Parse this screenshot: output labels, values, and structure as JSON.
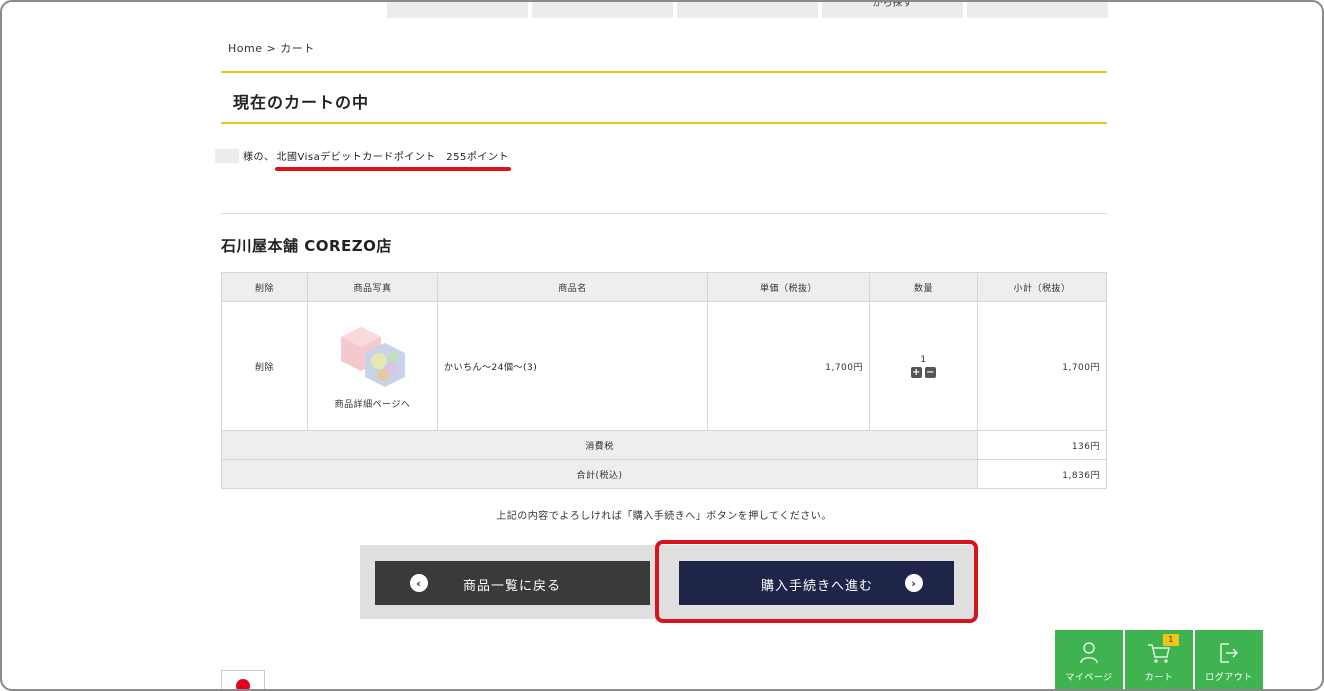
{
  "top_nav": {
    "tabs": [
      "",
      "",
      "",
      "から探す",
      ""
    ]
  },
  "breadcrumb": {
    "home": "Home",
    "sep": ">",
    "current": "カート"
  },
  "page_title": "現在のカートの中",
  "points": {
    "prefix": "様の、",
    "highlight": "北國Visaデビットカードポイント　255ポイント"
  },
  "shop": {
    "name": "石川屋本舗 COREZO店"
  },
  "table": {
    "headers": [
      "削除",
      "商品写真",
      "商品名",
      "単価（税抜）",
      "数量",
      "小計（税抜）"
    ],
    "item": {
      "delete": "削除",
      "photo_link": "商品詳細ページへ",
      "name": "かいちん〜24個〜(3)",
      "unit_price": "1,700円",
      "quantity": "1",
      "plus": "+",
      "minus": "−",
      "subtotal": "1,700円"
    },
    "tax_label": "消費税",
    "tax_value": "136円",
    "total_label": "合計(税込)",
    "total_value": "1,836円"
  },
  "notice": "上記の内容でよろしければ「購入手続きへ」ボタンを押してください。",
  "buttons": {
    "back": "商品一覧に戻る",
    "next": "購入手続きへ進む",
    "back_icon": "‹",
    "next_icon": "›"
  },
  "bottom_nav": {
    "mypage": "マイページ",
    "cart": "カート",
    "cart_badge": "1",
    "logout": "ログアウト"
  },
  "colors": {
    "accent_yellow": "#f0c419",
    "highlight_red": "#d8131c",
    "nav_green": "#3fb34f",
    "next_button": "#1f2549"
  }
}
